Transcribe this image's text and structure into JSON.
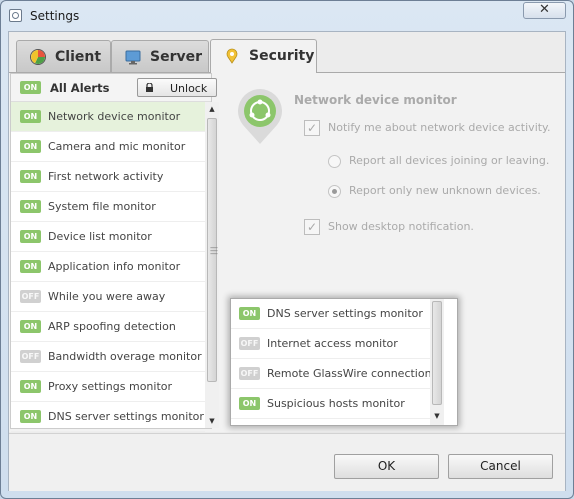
{
  "window": {
    "title": "Settings",
    "close_glyph": "✕"
  },
  "tabs": [
    {
      "label": "Client",
      "icon": "pie-chart-icon"
    },
    {
      "label": "Server",
      "icon": "monitor-icon"
    },
    {
      "label": "Security",
      "icon": "location-pin-icon",
      "active": true
    }
  ],
  "alerts": {
    "all_label": "All Alerts",
    "all_state": "ON",
    "unlock_label": "Unlock",
    "items": [
      {
        "state": "ON",
        "label": "Network device monitor",
        "selected": true
      },
      {
        "state": "ON",
        "label": "Camera and mic monitor"
      },
      {
        "state": "ON",
        "label": "First network activity"
      },
      {
        "state": "ON",
        "label": "System file monitor"
      },
      {
        "state": "ON",
        "label": "Device list monitor"
      },
      {
        "state": "ON",
        "label": "Application info monitor"
      },
      {
        "state": "OFF",
        "label": "While you were away"
      },
      {
        "state": "ON",
        "label": "ARP spoofing detection"
      },
      {
        "state": "OFF",
        "label": "Bandwidth overage monitor"
      },
      {
        "state": "ON",
        "label": "Proxy settings monitor"
      },
      {
        "state": "ON",
        "label": "DNS server settings monitor"
      }
    ]
  },
  "detail": {
    "title": "Network device monitor",
    "notify_label": "Notify me about network device activity.",
    "radio_all": "Report all devices joining or leaving.",
    "radio_unknown": "Report only new unknown devices.",
    "desktop_label": "Show desktop notification."
  },
  "popup": {
    "items": [
      {
        "state": "ON",
        "label": "DNS server settings monitor"
      },
      {
        "state": "OFF",
        "label": "Internet access monitor"
      },
      {
        "state": "OFF",
        "label": "Remote GlassWire connections"
      },
      {
        "state": "ON",
        "label": "Suspicious hosts monitor"
      }
    ]
  },
  "buttons": {
    "ok": "OK",
    "cancel": "Cancel"
  },
  "colors": {
    "on": "#8cc66b",
    "off": "#d0d0d0",
    "accent": "#f2c237"
  }
}
